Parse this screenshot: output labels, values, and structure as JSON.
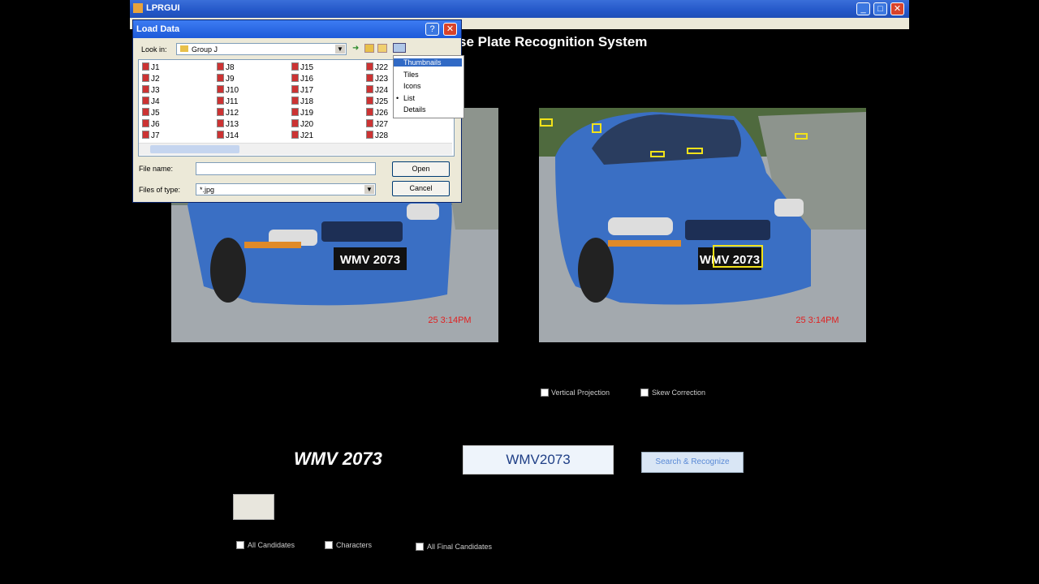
{
  "window": {
    "title": "LPRGUI"
  },
  "app": {
    "title": "se Plate Recognition System"
  },
  "dialog": {
    "title": "Load Data",
    "look_in_label": "Look in:",
    "look_in_value": "Group J",
    "file_name_label": "File name:",
    "file_name_value": "",
    "files_of_type_label": "Files of type:",
    "files_of_type_value": "*.jpg",
    "open_button": "Open",
    "cancel_button": "Cancel",
    "files": [
      "J1",
      "J2",
      "J3",
      "J4",
      "J5",
      "J6",
      "J7",
      "J8",
      "J9",
      "J10",
      "J11",
      "J12",
      "J13",
      "J14",
      "J15",
      "J16",
      "J17",
      "J18",
      "J19",
      "J20",
      "J21",
      "J22",
      "J23",
      "J24",
      "J25",
      "J26",
      "J27",
      "J28"
    ],
    "view_menu": [
      "Thumbnails",
      "Tiles",
      "Icons",
      "List",
      "Details"
    ],
    "view_menu_selected": "List"
  },
  "images": {
    "left_timestamp": "25  3:14PM",
    "right_timestamp": "25  3:14PM",
    "plate_text": "WMV 2073"
  },
  "options": {
    "vertical_projection": "Vertical Projection",
    "skew_correction": "Skew Correction",
    "all_candidates": "All Candidates",
    "characters": "Characters",
    "all_final_candidates": "All Final Candidates"
  },
  "result": {
    "plate_image_text": "WMV 2073",
    "recognized_text": "WMV2073",
    "search_button": "Search & Recognize"
  },
  "colors": {
    "car_blue": "#3a6fc4",
    "plate_box": "#f2e21a",
    "timestamp": "#e02020"
  }
}
